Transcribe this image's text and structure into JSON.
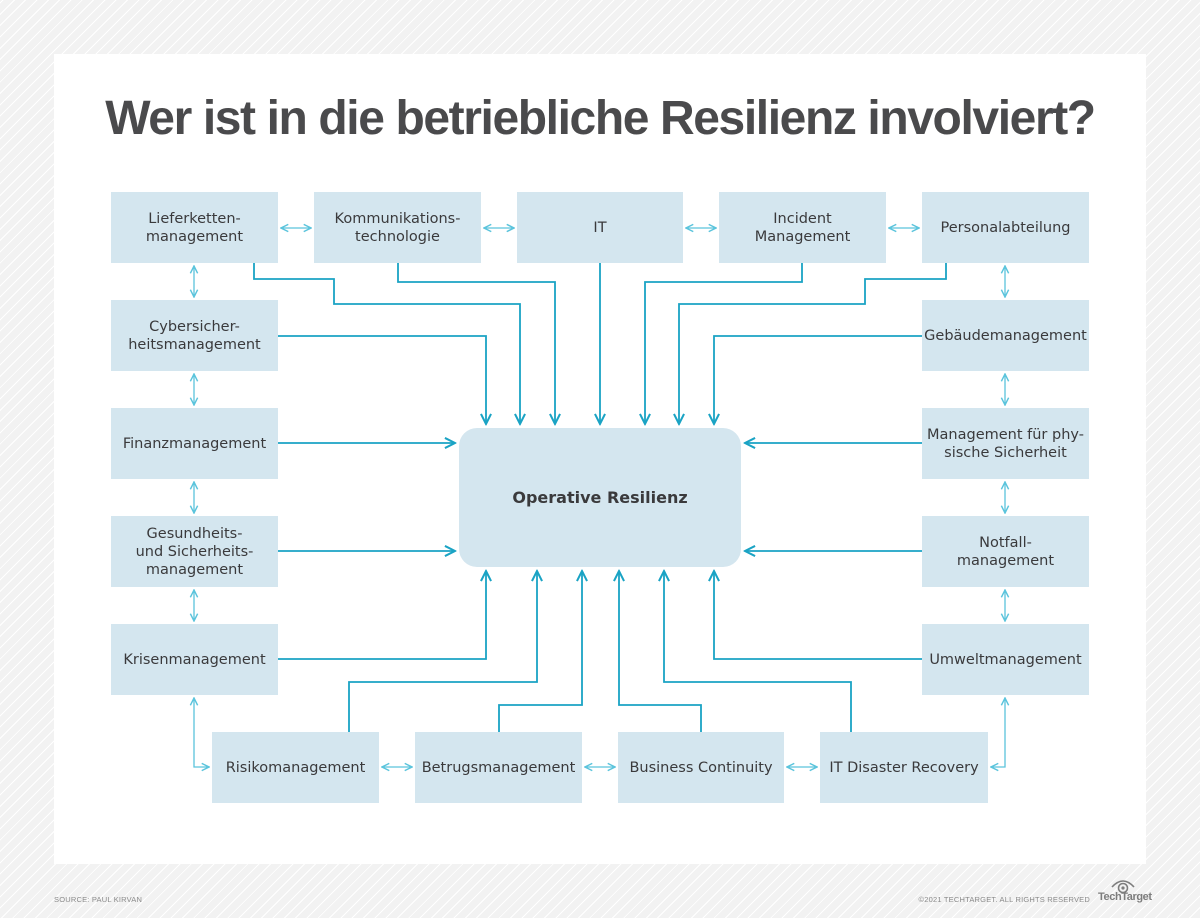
{
  "title": "Wer ist in die betriebliche Resilienz involviert?",
  "center": {
    "label": "Operative Resilienz"
  },
  "nodes": {
    "lieferketten": "Lieferketten-\nmanagement",
    "kommunikation": "Kommunikations-\ntechnologie",
    "it": "IT",
    "incident": "Incident\nManagement",
    "personal": "Personalabteilung",
    "cyber": "Cybersicher-\nheitsmanagement",
    "finanz": "Finanzmanagement",
    "gesundheit": "Gesundheits-\nund Sicherheits-\nmanagement",
    "krisen": "Krisenmanagement",
    "gebaeude": "Gebäudemanagement",
    "physisch": "Management für phy-\nsische Sicherheit",
    "notfall": "Notfall-\nmanagement",
    "umwelt": "Umweltmanagement",
    "risiko": "Risikomanagement",
    "betrug": "Betrugsmanagement",
    "continuity": "Business Continuity",
    "disaster": "IT Disaster Recovery"
  },
  "colors": {
    "box_fill": "#d4e6ef",
    "connector": "#1aa3c4",
    "peer_connector": "#5bc4dc",
    "title_text": "#4a4a4c"
  },
  "footer": {
    "source": "SOURCE: PAUL KIRVAN",
    "copyright": "©2021 TECHTARGET. ALL RIGHTS RESERVED",
    "brand": "TechTarget"
  }
}
